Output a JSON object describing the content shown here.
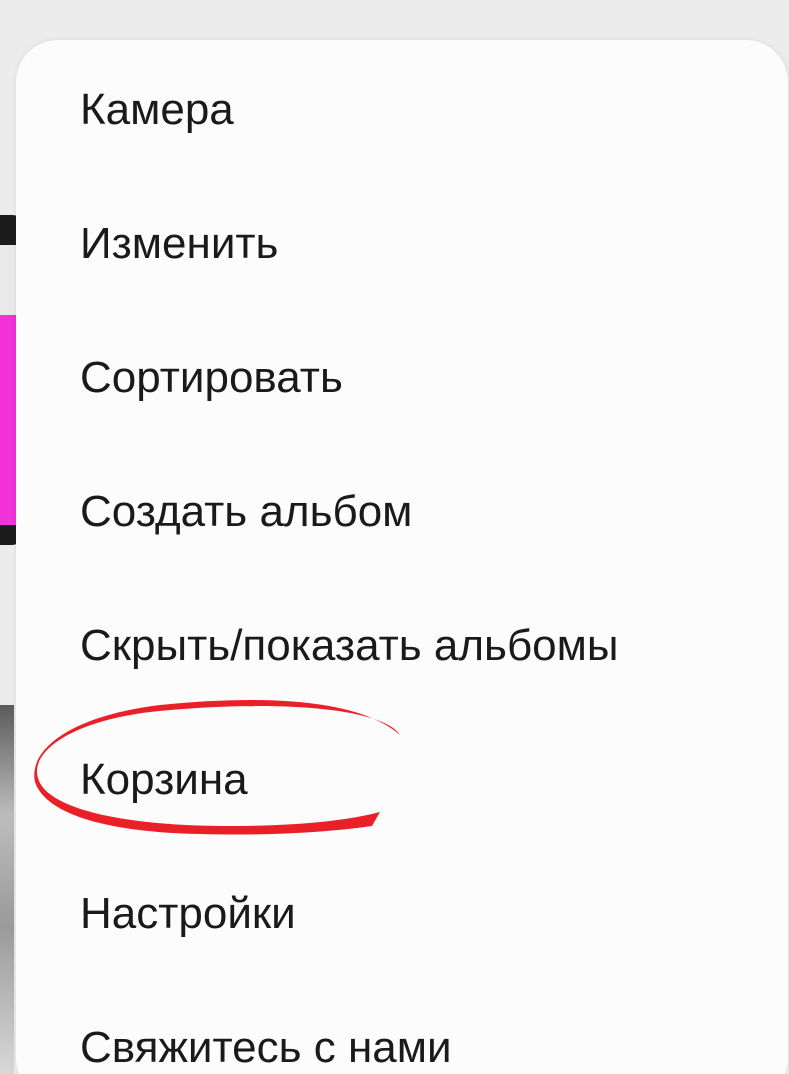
{
  "menu": {
    "items": [
      {
        "label": "Камера"
      },
      {
        "label": "Изменить"
      },
      {
        "label": "Сортировать"
      },
      {
        "label": "Создать альбом"
      },
      {
        "label": "Скрыть/показать альбомы"
      },
      {
        "label": "Корзина"
      },
      {
        "label": "Настройки"
      },
      {
        "label": "Свяжитесь с нами"
      }
    ]
  },
  "annotation": {
    "highlighted_item": "Корзина",
    "color": "#e8141c"
  },
  "colors": {
    "menu_background": "#fcfcfc",
    "text": "#1a1a1a",
    "backdrop": "#ececec",
    "thumbnail_accent": "#f032d8"
  }
}
